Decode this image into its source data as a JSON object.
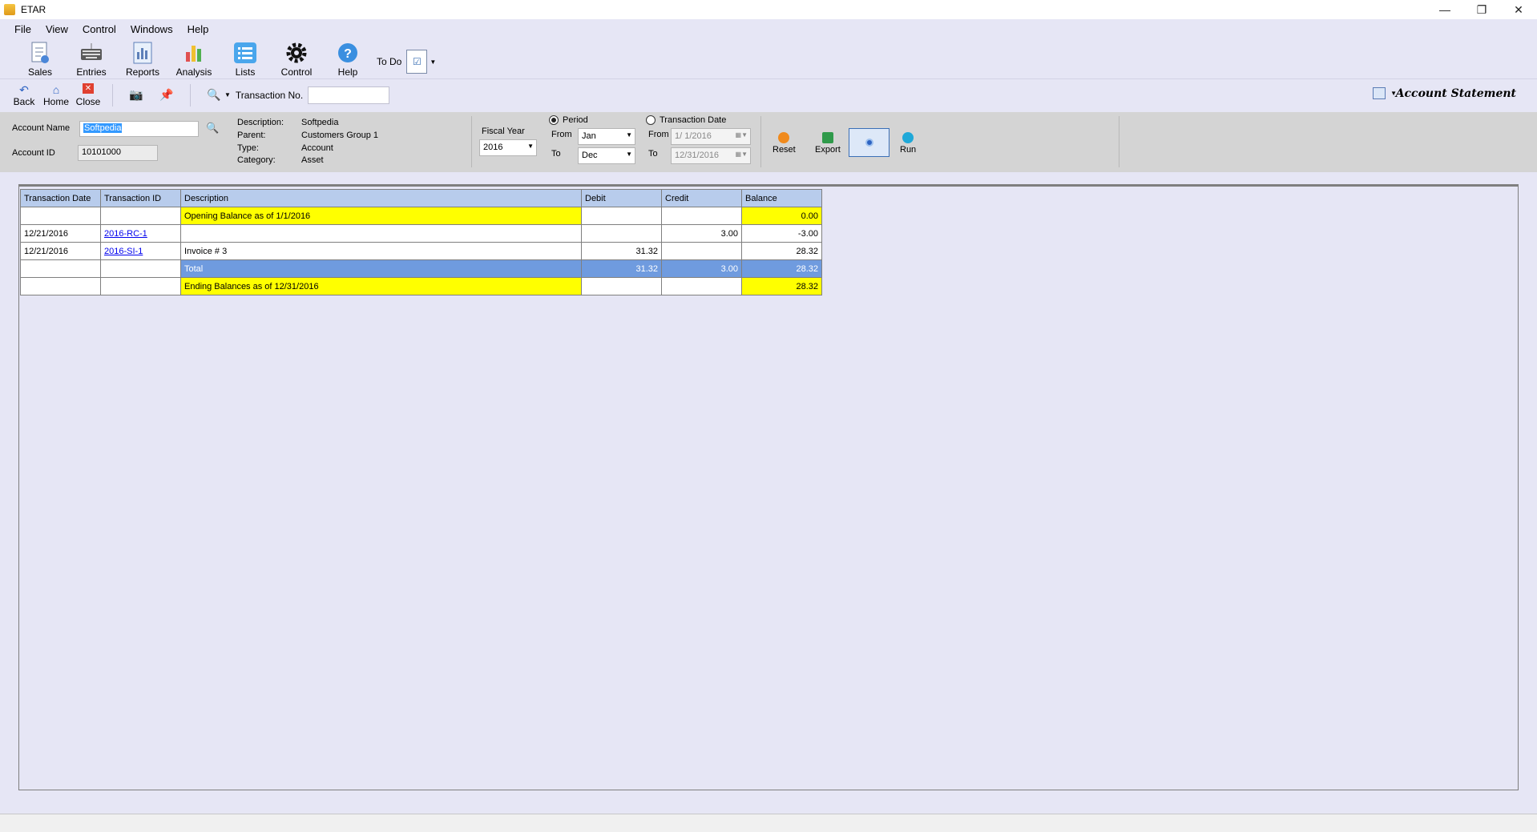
{
  "window": {
    "title": "ETAR",
    "minimize": "—",
    "maximize": "❐",
    "close": "✕"
  },
  "menu": [
    "File",
    "View",
    "Control",
    "Windows",
    "Help"
  ],
  "main_toolbar": {
    "sales": "Sales",
    "entries": "Entries",
    "reports": "Reports",
    "analysis": "Analysis",
    "lists": "Lists",
    "control": "Control",
    "help": "Help",
    "todo": "To Do"
  },
  "nav_toolbar": {
    "back": "Back",
    "home": "Home",
    "close": "Close",
    "transaction_no_label": "Transaction No.",
    "transaction_no_value": ""
  },
  "report_title": "Account Statement",
  "filters": {
    "account_name_label": "Account Name",
    "account_name": "Softpedia",
    "account_id_label": "Account ID",
    "account_id": "10101000",
    "description_label": "Description:",
    "description": "Softpedia",
    "parent_label": "Parent:",
    "parent": "Customers Group 1",
    "type_label": "Type:",
    "type": "Account",
    "category_label": "Category:",
    "category": "Asset",
    "fiscal_year_label": "Fiscal Year",
    "fiscal_year": "2016",
    "period_label": "Period",
    "period_selected": true,
    "from_label": "From",
    "from_month": "Jan",
    "to_label": "To",
    "to_month": "Dec",
    "txn_date_label": "Transaction Date",
    "txn_from_label": "From",
    "txn_from": "1/ 1/2016",
    "txn_to_label": "To",
    "txn_to": "12/31/2016"
  },
  "actions": {
    "reset": "Reset",
    "export": "Export",
    "run": "Run"
  },
  "grid": {
    "columns": [
      "Transaction Date",
      "Transaction ID",
      "Description",
      "Debit",
      "Credit",
      "Balance"
    ],
    "opening": {
      "description": "Opening Balance as of 1/1/2016",
      "balance": "0.00"
    },
    "rows": [
      {
        "date": "12/21/2016",
        "id": "2016-RC-1",
        "description": "",
        "debit": "",
        "credit": "3.00",
        "balance": "-3.00"
      },
      {
        "date": "12/21/2016",
        "id": "2016-SI-1",
        "description": "Invoice # 3",
        "debit": "31.32",
        "credit": "",
        "balance": "28.32"
      }
    ],
    "total": {
      "description": "Total",
      "debit": "31.32",
      "credit": "3.00",
      "balance": "28.32"
    },
    "ending": {
      "description": "Ending Balances as of 12/31/2016",
      "balance": "28.32"
    }
  },
  "colors": {
    "header": "#b8ccec",
    "highlight": "#ffff00",
    "total": "#6f9bdf",
    "background": "#e6e6f5"
  }
}
